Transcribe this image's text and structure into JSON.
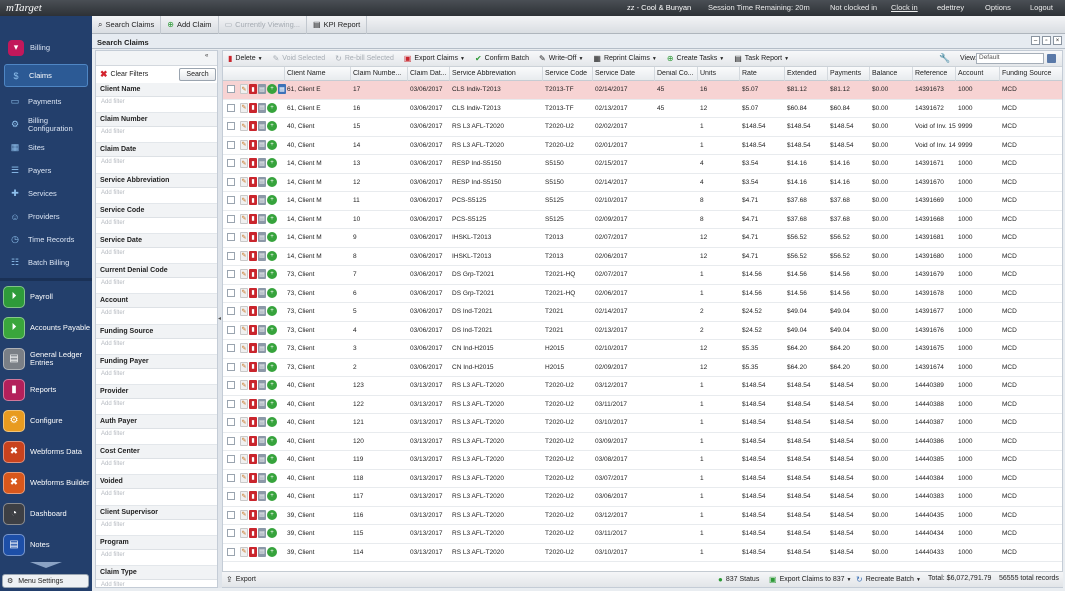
{
  "app": {
    "logo": "mTarget",
    "title": "zz - Cool & Bunyan",
    "session": "Session Time Remaining: 20m",
    "clock_status": "Not clocked in",
    "clock_in": "Clock in",
    "user": "edettrey",
    "options": "Options",
    "logout": "Logout"
  },
  "toolbar": {
    "search_claims": "Search Claims",
    "add_claim": "Add Claim",
    "currently_viewing": "Currently Viewing...",
    "kpi_report": "KPI Report"
  },
  "sidebar": {
    "top_items": [
      {
        "label": "Billing",
        "icon": "chevron-down-icon"
      },
      {
        "label": "Claims",
        "icon": "dollar-icon"
      },
      {
        "label": "Payments",
        "icon": "payment-icon"
      },
      {
        "label": "Billing Configuration",
        "icon": "config-icon"
      },
      {
        "label": "Sites",
        "icon": "sites-icon"
      },
      {
        "label": "Payers",
        "icon": "payers-icon"
      },
      {
        "label": "Services",
        "icon": "services-icon"
      },
      {
        "label": "Providers",
        "icon": "providers-icon"
      },
      {
        "label": "Time Records",
        "icon": "clock-icon"
      },
      {
        "label": "Batch Billing",
        "icon": "batch-icon"
      }
    ],
    "modules": [
      {
        "label": "Payroll",
        "color": "#2e9b3a"
      },
      {
        "label": "Accounts Payable",
        "color": "#3aa63c"
      },
      {
        "label": "General Ledger Entries",
        "color": "#7a7f86"
      },
      {
        "label": "Reports",
        "color": "#b3205b"
      },
      {
        "label": "Configure",
        "color": "#e89b20"
      },
      {
        "label": "Webforms Data",
        "color": "#c9421d"
      },
      {
        "label": "Webforms Builder",
        "color": "#d8571c"
      },
      {
        "label": "Dashboard",
        "color": "#3d3f44"
      },
      {
        "label": "Notes",
        "color": "#1d4fa8"
      }
    ],
    "menu_settings": "Menu Settings"
  },
  "panel": {
    "title": "Search Claims"
  },
  "filters": {
    "clear": "Clear Filters",
    "search": "Search",
    "placeholder": "Add filter",
    "groups": [
      "Client Name",
      "Claim Number",
      "Claim Date",
      "Service Abbreviation",
      "Service Code",
      "Service Date",
      "Current Denial Code",
      "Account",
      "Funding Source",
      "Funding Payer",
      "Provider",
      "Auth Payer",
      "Cost Center",
      "Voided",
      "Client Supervisor",
      "Program",
      "Claim Type"
    ]
  },
  "grid_toolbar": {
    "delete": "Delete",
    "void": "Void Selected",
    "rebill": "Re-bill Selected",
    "export": "Export Claims",
    "confirm": "Confirm Batch",
    "writeoff": "Write-Off",
    "reprint": "Reprint Claims",
    "create_tasks": "Create Tasks",
    "task_report": "Task Report",
    "view_label": "View:",
    "view_value": "Default"
  },
  "columns": [
    "Client Name",
    "Claim Numbe...",
    "Claim Dat...",
    "Service Abbreviation",
    "Service Code",
    "Service Date",
    "Denial Co...",
    "Units",
    "Rate",
    "Extended",
    "Payments",
    "Balance",
    "Reference",
    "Account",
    "Funding Source"
  ],
  "rows": [
    [
      "61, Client E",
      "17",
      "03/06/2017",
      "CLS Indiv-T2013",
      "T2013-TF",
      "02/14/2017",
      "45",
      "16",
      "$5.07",
      "$81.12",
      "$81.12",
      "$0.00",
      "14391673",
      "1000",
      "MCD"
    ],
    [
      "61, Client E",
      "16",
      "03/06/2017",
      "CLS Indiv-T2013",
      "T2013-TF",
      "02/13/2017",
      "45",
      "12",
      "$5.07",
      "$60.84",
      "$60.84",
      "$0.00",
      "14391672",
      "1000",
      "MCD"
    ],
    [
      "40, Client",
      "15",
      "03/06/2017",
      "RS L3 AFL-T2020",
      "T2020-U2",
      "02/02/2017",
      "",
      "1",
      "$148.54",
      "$148.54",
      "$148.54",
      "$0.00",
      "Void of Inv. 15",
      "9999",
      "MCD"
    ],
    [
      "40, Client",
      "14",
      "03/06/2017",
      "RS L3 AFL-T2020",
      "T2020-U2",
      "02/01/2017",
      "",
      "1",
      "$148.54",
      "$148.54",
      "$148.54",
      "$0.00",
      "Void of Inv. 14",
      "9999",
      "MCD"
    ],
    [
      "14, Client M",
      "13",
      "03/06/2017",
      "RESP Ind-S5150",
      "S5150",
      "02/15/2017",
      "",
      "4",
      "$3.54",
      "$14.16",
      "$14.16",
      "$0.00",
      "14391671",
      "1000",
      "MCD"
    ],
    [
      "14, Client M",
      "12",
      "03/06/2017",
      "RESP Ind-S5150",
      "S5150",
      "02/14/2017",
      "",
      "4",
      "$3.54",
      "$14.16",
      "$14.16",
      "$0.00",
      "14391670",
      "1000",
      "MCD"
    ],
    [
      "14, Client M",
      "11",
      "03/06/2017",
      "PCS-S5125",
      "S5125",
      "02/10/2017",
      "",
      "8",
      "$4.71",
      "$37.68",
      "$37.68",
      "$0.00",
      "14391669",
      "1000",
      "MCD"
    ],
    [
      "14, Client M",
      "10",
      "03/06/2017",
      "PCS-S5125",
      "S5125",
      "02/09/2017",
      "",
      "8",
      "$4.71",
      "$37.68",
      "$37.68",
      "$0.00",
      "14391668",
      "1000",
      "MCD"
    ],
    [
      "14, Client M",
      "9",
      "03/06/2017",
      "IHSKL-T2013",
      "T2013",
      "02/07/2017",
      "",
      "12",
      "$4.71",
      "$56.52",
      "$56.52",
      "$0.00",
      "14391681",
      "1000",
      "MCD"
    ],
    [
      "14, Client M",
      "8",
      "03/06/2017",
      "IHSKL-T2013",
      "T2013",
      "02/06/2017",
      "",
      "12",
      "$4.71",
      "$56.52",
      "$56.52",
      "$0.00",
      "14391680",
      "1000",
      "MCD"
    ],
    [
      "73, Client",
      "7",
      "03/06/2017",
      "DS Grp-T2021",
      "T2021-HQ",
      "02/07/2017",
      "",
      "1",
      "$14.56",
      "$14.56",
      "$14.56",
      "$0.00",
      "14391679",
      "1000",
      "MCD"
    ],
    [
      "73, Client",
      "6",
      "03/06/2017",
      "DS Grp-T2021",
      "T2021-HQ",
      "02/06/2017",
      "",
      "1",
      "$14.56",
      "$14.56",
      "$14.56",
      "$0.00",
      "14391678",
      "1000",
      "MCD"
    ],
    [
      "73, Client",
      "5",
      "03/06/2017",
      "DS Ind-T2021",
      "T2021",
      "02/14/2017",
      "",
      "2",
      "$24.52",
      "$49.04",
      "$49.04",
      "$0.00",
      "14391677",
      "1000",
      "MCD"
    ],
    [
      "73, Client",
      "4",
      "03/06/2017",
      "DS Ind-T2021",
      "T2021",
      "02/13/2017",
      "",
      "2",
      "$24.52",
      "$49.04",
      "$49.04",
      "$0.00",
      "14391676",
      "1000",
      "MCD"
    ],
    [
      "73, Client",
      "3",
      "03/06/2017",
      "CN Ind-H2015",
      "H2015",
      "02/10/2017",
      "",
      "12",
      "$5.35",
      "$64.20",
      "$64.20",
      "$0.00",
      "14391675",
      "1000",
      "MCD"
    ],
    [
      "73, Client",
      "2",
      "03/06/2017",
      "CN Ind-H2015",
      "H2015",
      "02/09/2017",
      "",
      "12",
      "$5.35",
      "$64.20",
      "$64.20",
      "$0.00",
      "14391674",
      "1000",
      "MCD"
    ],
    [
      "40, Client",
      "123",
      "03/13/2017",
      "RS L3 AFL-T2020",
      "T2020-U2",
      "03/12/2017",
      "",
      "1",
      "$148.54",
      "$148.54",
      "$148.54",
      "$0.00",
      "14440389",
      "1000",
      "MCD"
    ],
    [
      "40, Client",
      "122",
      "03/13/2017",
      "RS L3 AFL-T2020",
      "T2020-U2",
      "03/11/2017",
      "",
      "1",
      "$148.54",
      "$148.54",
      "$148.54",
      "$0.00",
      "14440388",
      "1000",
      "MCD"
    ],
    [
      "40, Client",
      "121",
      "03/13/2017",
      "RS L3 AFL-T2020",
      "T2020-U2",
      "03/10/2017",
      "",
      "1",
      "$148.54",
      "$148.54",
      "$148.54",
      "$0.00",
      "14440387",
      "1000",
      "MCD"
    ],
    [
      "40, Client",
      "120",
      "03/13/2017",
      "RS L3 AFL-T2020",
      "T2020-U2",
      "03/09/2017",
      "",
      "1",
      "$148.54",
      "$148.54",
      "$148.54",
      "$0.00",
      "14440386",
      "1000",
      "MCD"
    ],
    [
      "40, Client",
      "119",
      "03/13/2017",
      "RS L3 AFL-T2020",
      "T2020-U2",
      "03/08/2017",
      "",
      "1",
      "$148.54",
      "$148.54",
      "$148.54",
      "$0.00",
      "14440385",
      "1000",
      "MCD"
    ],
    [
      "40, Client",
      "118",
      "03/13/2017",
      "RS L3 AFL-T2020",
      "T2020-U2",
      "03/07/2017",
      "",
      "1",
      "$148.54",
      "$148.54",
      "$148.54",
      "$0.00",
      "14440384",
      "1000",
      "MCD"
    ],
    [
      "40, Client",
      "117",
      "03/13/2017",
      "RS L3 AFL-T2020",
      "T2020-U2",
      "03/06/2017",
      "",
      "1",
      "$148.54",
      "$148.54",
      "$148.54",
      "$0.00",
      "14440383",
      "1000",
      "MCD"
    ],
    [
      "39, Client",
      "116",
      "03/13/2017",
      "RS L3 AFL-T2020",
      "T2020-U2",
      "03/12/2017",
      "",
      "1",
      "$148.54",
      "$148.54",
      "$148.54",
      "$0.00",
      "14440435",
      "1000",
      "MCD"
    ],
    [
      "39, Client",
      "115",
      "03/13/2017",
      "RS L3 AFL-T2020",
      "T2020-U2",
      "03/11/2017",
      "",
      "1",
      "$148.54",
      "$148.54",
      "$148.54",
      "$0.00",
      "14440434",
      "1000",
      "MCD"
    ],
    [
      "39, Client",
      "114",
      "03/13/2017",
      "RS L3 AFL-T2020",
      "T2020-U2",
      "03/10/2017",
      "",
      "1",
      "$148.54",
      "$148.54",
      "$148.54",
      "$0.00",
      "14440433",
      "1000",
      "MCD"
    ]
  ],
  "highlight_color": "#f7d3d3",
  "footer": {
    "export": "Export",
    "status_837": "837 Status",
    "export_837": "Export Claims to 837",
    "recreate": "Recreate Batch",
    "total": "Total: $6,072,791.79",
    "records": "56555 total records"
  }
}
